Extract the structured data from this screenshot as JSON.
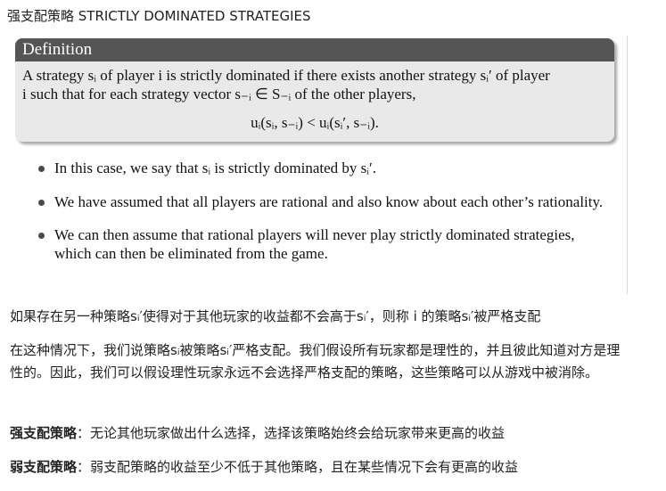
{
  "page": {
    "title": "强支配策略 STRICTLY DOMINATED STRATEGIES"
  },
  "definition": {
    "heading": "Definition",
    "line1": "A strategy sᵢ of player i is strictly dominated if there exists another strategy sᵢ′ of player",
    "line2": "i such that for each strategy vector s₋ᵢ ∈ S₋ᵢ of the other players,",
    "formula": "uᵢ(sᵢ, s₋ᵢ) < uᵢ(sᵢ′, s₋ᵢ)."
  },
  "bullets": [
    "In this case, we say that sᵢ is strictly dominated by sᵢ′.",
    "We have assumed that all players are rational and also know about each other’s rationality.",
    "We can then assume that rational players will never play strictly dominated strategies, which can then be eliminated from the game."
  ],
  "notes": {
    "p1": "如果存在另一种策略sᵢ′使得对于其他玩家的收益都不会高于sᵢ′，则称 i 的策略sᵢ′被严格支配",
    "p2": "在这种情况下，我们说策略sᵢ被策略sᵢ′严格支配。我们假设所有玩家都是理性的，并且彼此知道对方是理性的。因此，我们可以假设理性玩家永远不会选择严格支配的策略，这些策略可以从游戏中被消除。",
    "p3_label": "强支配策略",
    "p3_text": "：无论其他玩家做出什么选择，选择该策略始终会给玩家带来更高的收益",
    "p4_label": "弱支配策略",
    "p4_text": "：弱支配策略的收益至少不低于其他策略，且在某些情况下会有更高的收益"
  }
}
